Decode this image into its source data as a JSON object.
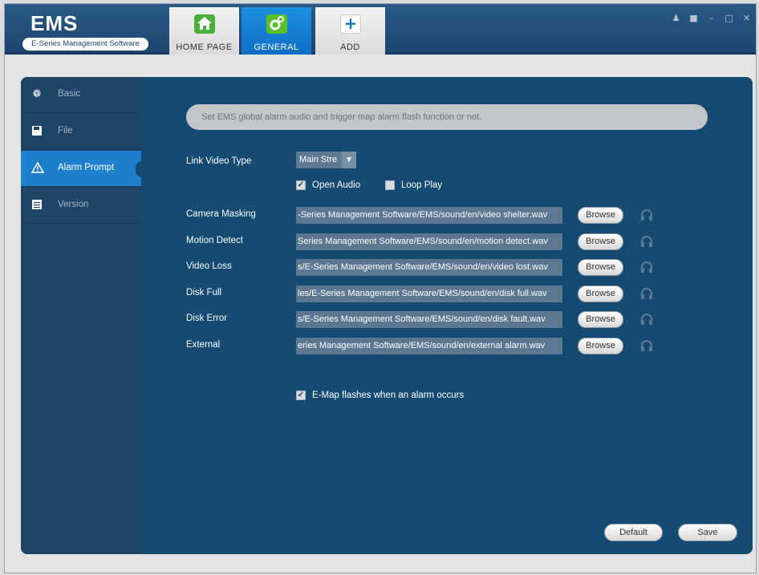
{
  "app": {
    "logo_title": "EMS",
    "logo_subtitle": "E-Series Management Software"
  },
  "nav": {
    "tabs": [
      {
        "label": "HOME PAGE",
        "icon": "home-icon"
      },
      {
        "label": "GENERAL",
        "icon": "gear-icon",
        "active": true
      },
      {
        "label": "ADD",
        "icon": "plus-icon"
      }
    ],
    "window_controls": [
      "user-icon",
      "lock-icon",
      "minimize-icon",
      "maximize-icon",
      "close-icon"
    ]
  },
  "sidebar": {
    "items": [
      {
        "label": "Basic",
        "icon": "gear-icon"
      },
      {
        "label": "File",
        "icon": "floppy-icon"
      },
      {
        "label": "Alarm Prompt",
        "icon": "warning-icon",
        "active": true
      },
      {
        "label": "Version",
        "icon": "document-icon"
      }
    ]
  },
  "main": {
    "info": "Set EMS global alarm audio and trigger map alarm flash function or not.",
    "link_video_type_label": "Link Video Type",
    "link_video_type_value": "Main Stre",
    "open_audio_label": "Open Audio",
    "open_audio_checked": true,
    "loop_play_label": "Loop Play",
    "loop_play_checked": false,
    "alarms": [
      {
        "label": "Camera Masking",
        "path": "-Series Management Software/EMS/sound/en/video shelter.wav",
        "button": "Browse"
      },
      {
        "label": "Motion Detect",
        "path": "Series Management Software/EMS/sound/en/motion detect.wav",
        "button": "Browse"
      },
      {
        "label": "Video Loss",
        "path": "s/E-Series Management Software/EMS/sound/en/video lost.wav",
        "button": "Browse"
      },
      {
        "label": "Disk Full",
        "path": "les/E-Series Management Software/EMS/sound/en/disk full.wav",
        "button": "Browse"
      },
      {
        "label": "Disk Error",
        "path": "s/E-Series Management Software/EMS/sound/en/disk fault.wav",
        "button": "Browse"
      },
      {
        "label": "External",
        "path": "eries Management Software/EMS/sound/en/external alarm.wav",
        "button": "Browse"
      }
    ],
    "emap_label": "E-Map flashes when an alarm occurs",
    "emap_checked": true,
    "default_label": "Default",
    "save_label": "Save"
  },
  "colors": {
    "topbar": "#1d4670",
    "panel": "#154a73",
    "sidebar": "#1e4468",
    "active": "#1f7fcf"
  }
}
